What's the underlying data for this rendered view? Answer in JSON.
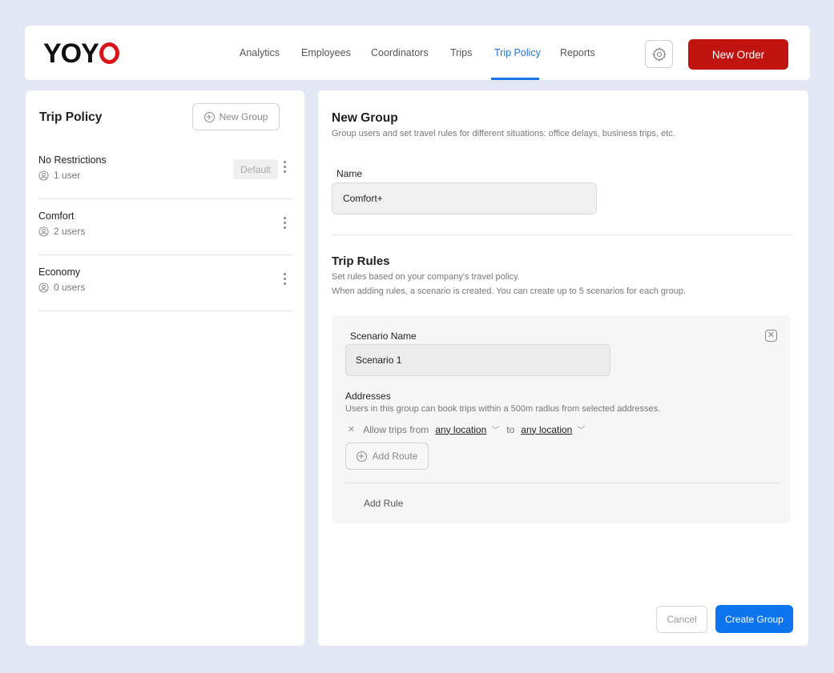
{
  "header": {
    "logo_text": "YOY",
    "nav": [
      {
        "label": "Analytics"
      },
      {
        "label": "Employees"
      },
      {
        "label": "Coordinators"
      },
      {
        "label": "Trips"
      },
      {
        "label": "Trip Policy",
        "active": true
      },
      {
        "label": "Reports"
      }
    ],
    "settings_icon": "gear-icon",
    "new_order_label": "New Order",
    "brand_red": "#c1130f",
    "accent_blue": "#1a74e8"
  },
  "sidebar": {
    "title": "Trip Policy",
    "new_group_label": "New Group",
    "groups": [
      {
        "name": "No Restrictions",
        "users": "1 user",
        "badge": "Default"
      },
      {
        "name": "Comfort",
        "users": "2 users"
      },
      {
        "name": "Economy",
        "users": "0 users"
      }
    ]
  },
  "form": {
    "title": "New Group",
    "subtitle": "Group users and set travel rules for different situations: office delays, business trips, etc.",
    "name_label": "Name",
    "name_value": "Comfort+",
    "rules_title": "Trip Rules",
    "rules_sub1": "Set rules based on your company's travel policy.",
    "rules_sub2": "When adding rules, a scenario is created. You can create up to 5 scenarios for each group.",
    "scenario": {
      "label": "Scenario Name",
      "value": "Scenario 1",
      "addresses_title": "Addresses",
      "addresses_desc": "Users in this group can book trips within a 500m radius from selected addresses.",
      "route_prefix": "Allow trips from",
      "route_from": "any location",
      "route_to_word": "to",
      "route_to": "any location",
      "add_route_label": "Add Route",
      "add_rule_label": "Add Rule"
    },
    "cancel_label": "Cancel",
    "create_label": "Create Group"
  }
}
